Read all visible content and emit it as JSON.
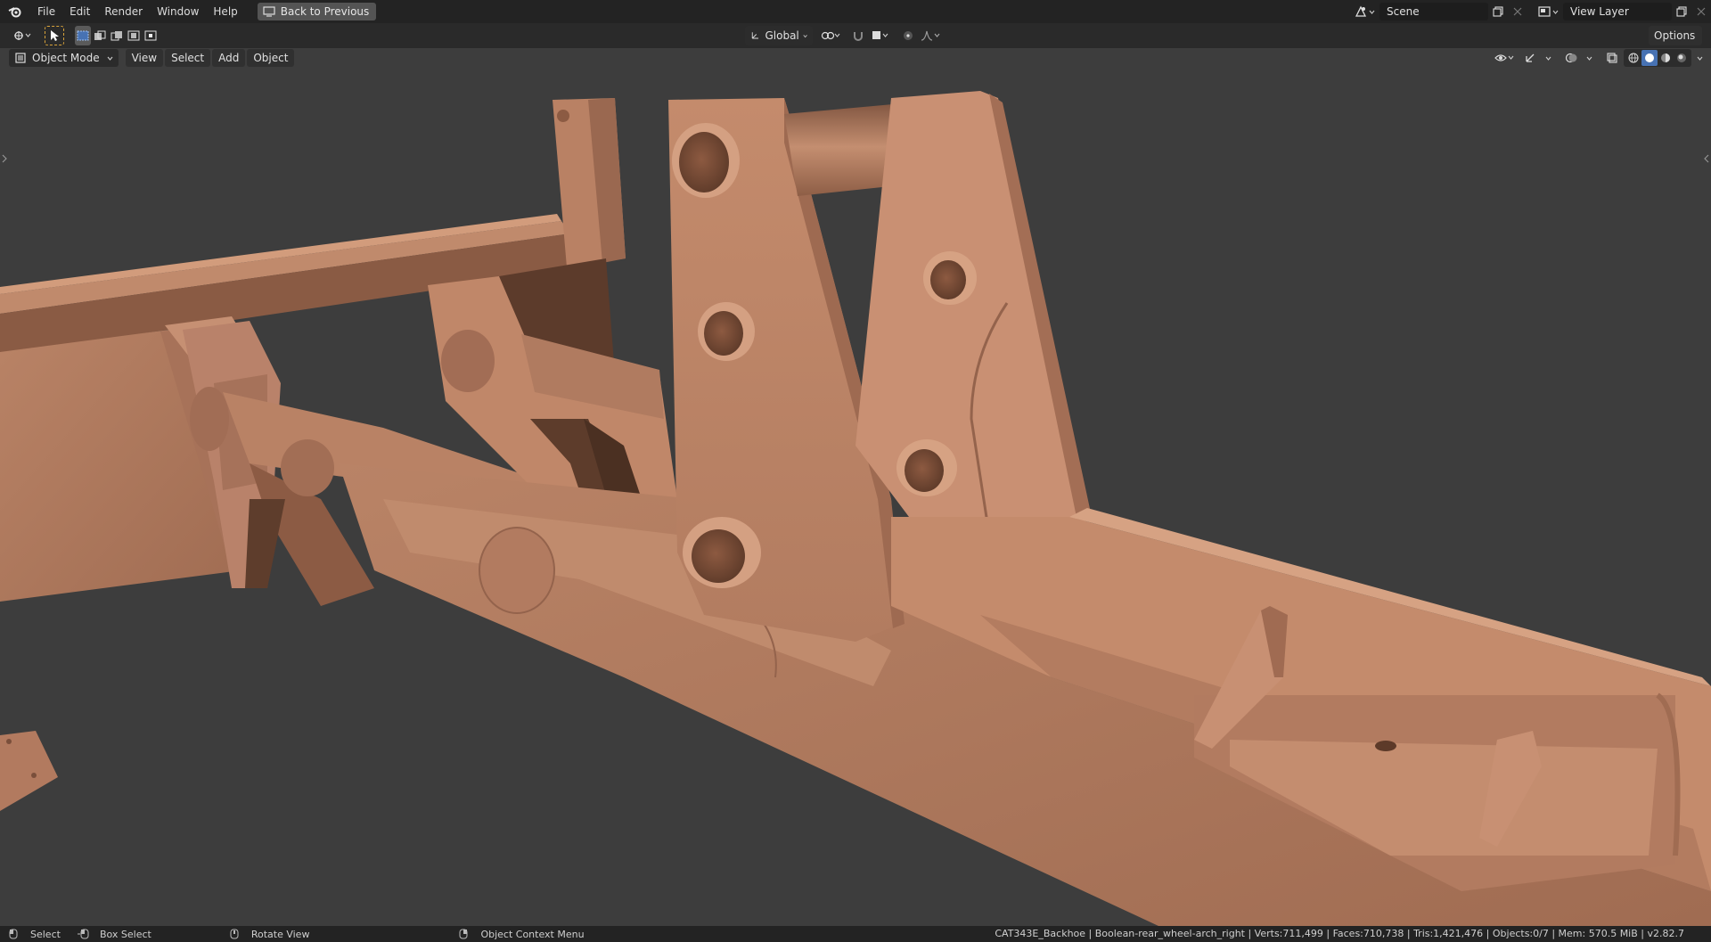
{
  "topbar": {
    "menus": [
      "File",
      "Edit",
      "Render",
      "Window",
      "Help"
    ],
    "back_label": "Back to Previous",
    "scene_name": "Scene",
    "view_layer": "View Layer"
  },
  "toolrow": {
    "orientation": "Global",
    "options_label": "Options"
  },
  "viewport_header": {
    "mode": "Object Mode",
    "menus": [
      "View",
      "Select",
      "Add",
      "Object"
    ]
  },
  "statusbar": {
    "select_label": "Select",
    "box_select_label": "Box Select",
    "rotate_label": "Rotate View",
    "context_menu_label": "Object Context Menu",
    "stats": "CAT343E_Backhoe | Boolean-rear_wheel-arch_right | Verts:711,499 | Faces:710,738 | Tris:1,421,476 | Objects:0/7 | Mem: 570.5 MiB | v2.82.7"
  },
  "colors": {
    "accent": "#4772b3",
    "model": "#c48a6c",
    "background": "#3d3d3d"
  }
}
